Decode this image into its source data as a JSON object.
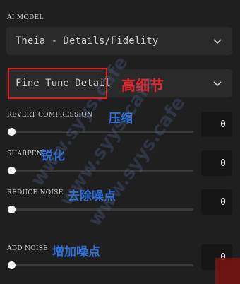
{
  "ai_model": {
    "label": "AI MODEL",
    "selected": "Theia - Details/Fidelity"
  },
  "mode": {
    "selected": "Fine Tune Detail",
    "annotation": "高细节"
  },
  "sliders": [
    {
      "label": "REVERT COMPRESSION",
      "annotation": "压缩",
      "value": "0",
      "level": 0
    },
    {
      "label": "SHARPEN",
      "annotation": "锐化",
      "value": "0",
      "level": 0
    },
    {
      "label": "REDUCE NOISE",
      "annotation": "去除噪点",
      "value": "0",
      "level": 0
    },
    {
      "label": "ADD NOISE",
      "annotation": "增加噪点",
      "value": "0",
      "level": 0
    }
  ],
  "watermark": "www.syys.cafe",
  "icons": {
    "dropdown": "chevron-down-icon"
  }
}
